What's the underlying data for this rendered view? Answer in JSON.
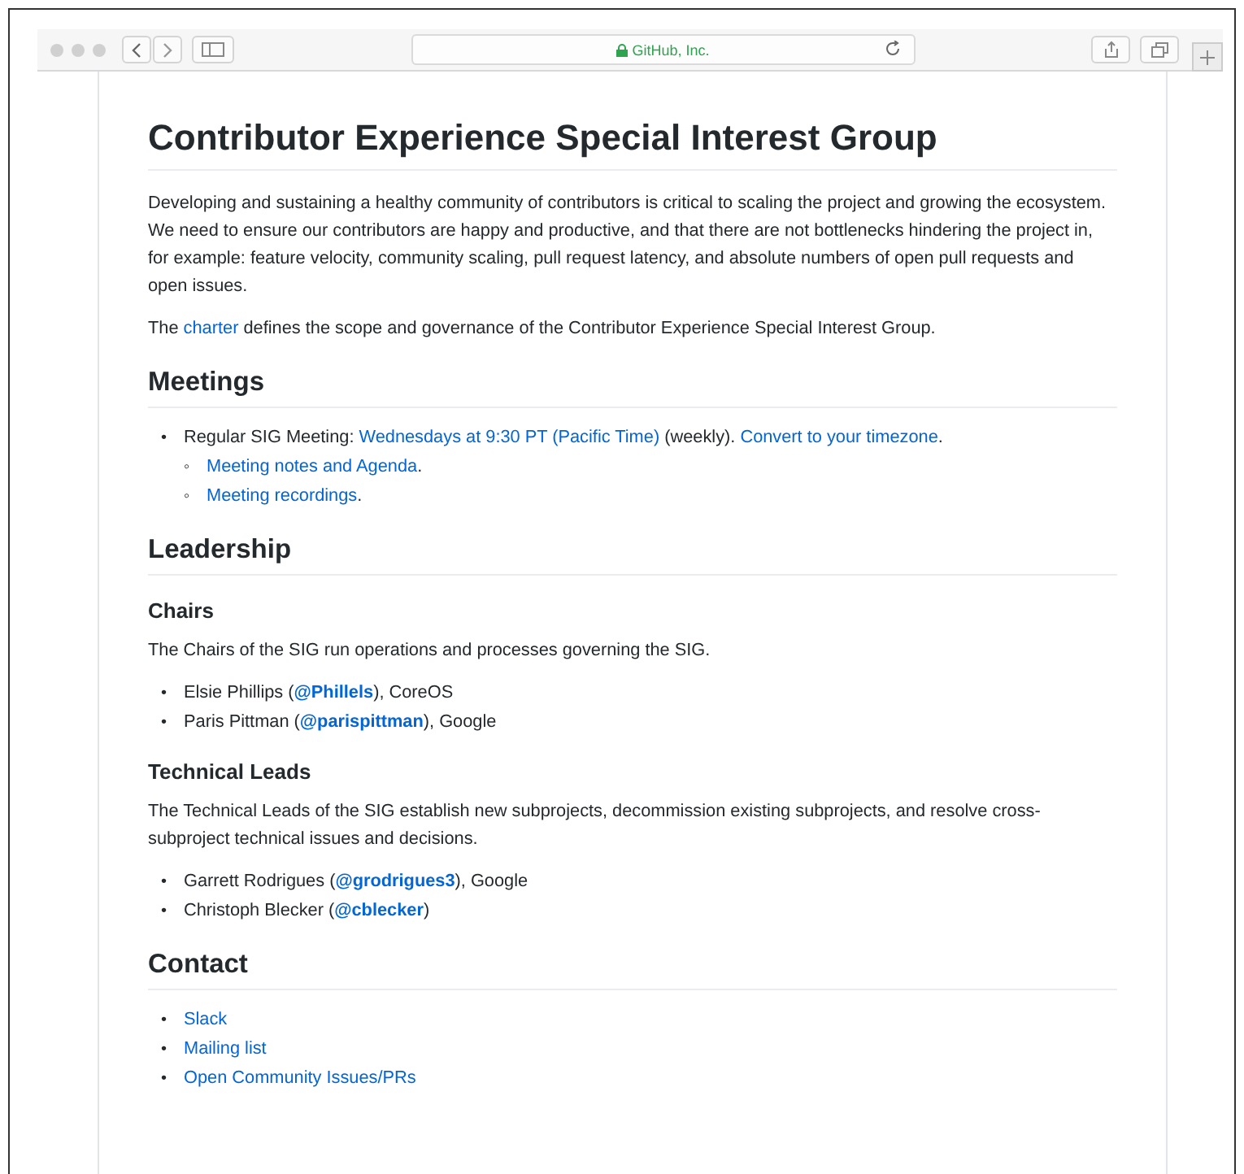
{
  "browser": {
    "address": "GitHub, Inc.",
    "secure": true
  },
  "blocks": [
    {
      "kind": "h1",
      "text": "Contributor Experience Special Interest Group"
    },
    {
      "kind": "p",
      "segments": [
        {
          "kind": "text",
          "text": "Developing and sustaining a healthy community of contributors is critical to scaling the project and growing the ecosystem. We need to ensure our contributors are happy and productive, and that there are not bottlenecks hindering the project in, for example: feature velocity, community scaling, pull request latency, and absolute numbers of open pull requests and open issues."
        }
      ]
    },
    {
      "kind": "p",
      "segments": [
        {
          "kind": "text",
          "text": "The "
        },
        {
          "kind": "link",
          "text": "charter"
        },
        {
          "kind": "text",
          "text": " defines the scope and governance of the Contributor Experience Special Interest Group."
        }
      ]
    },
    {
      "kind": "h2",
      "text": "Meetings"
    },
    {
      "kind": "list",
      "items": [
        {
          "marker": "•",
          "segments": [
            {
              "kind": "text",
              "text": "Regular SIG Meeting: "
            },
            {
              "kind": "link",
              "text": "Wednesdays at 9:30 PT (Pacific Time)"
            },
            {
              "kind": "text",
              "text": " (weekly). "
            },
            {
              "kind": "link",
              "text": "Convert to your timezone"
            },
            {
              "kind": "text",
              "text": "."
            }
          ],
          "children": [
            {
              "marker": "◦",
              "segments": [
                {
                  "kind": "link",
                  "text": "Meeting notes and Agenda"
                },
                {
                  "kind": "text",
                  "text": "."
                }
              ]
            },
            {
              "marker": "◦",
              "segments": [
                {
                  "kind": "link",
                  "text": "Meeting recordings"
                },
                {
                  "kind": "text",
                  "text": "."
                }
              ]
            }
          ]
        }
      ]
    },
    {
      "kind": "h2",
      "text": "Leadership"
    },
    {
      "kind": "h3",
      "text": "Chairs"
    },
    {
      "kind": "p",
      "segments": [
        {
          "kind": "text",
          "text": "The Chairs of the SIG run operations and processes governing the SIG."
        }
      ]
    },
    {
      "kind": "list",
      "items": [
        {
          "marker": "•",
          "segments": [
            {
              "kind": "text",
              "text": "Elsie Phillips ("
            },
            {
              "kind": "handle",
              "text": "@Phillels"
            },
            {
              "kind": "text",
              "text": "), CoreOS"
            }
          ]
        },
        {
          "marker": "•",
          "segments": [
            {
              "kind": "text",
              "text": "Paris Pittman ("
            },
            {
              "kind": "handle",
              "text": "@parispittman"
            },
            {
              "kind": "text",
              "text": "), Google"
            }
          ]
        }
      ]
    },
    {
      "kind": "h3",
      "text": "Technical Leads"
    },
    {
      "kind": "p",
      "segments": [
        {
          "kind": "text",
          "text": "The Technical Leads of the SIG establish new subprojects, decommission existing subprojects, and resolve cross-subproject technical issues and decisions."
        }
      ]
    },
    {
      "kind": "list",
      "items": [
        {
          "marker": "•",
          "segments": [
            {
              "kind": "text",
              "text": "Garrett Rodrigues ("
            },
            {
              "kind": "handle",
              "text": "@grodrigues3"
            },
            {
              "kind": "text",
              "text": "), Google"
            }
          ]
        },
        {
          "marker": "•",
          "segments": [
            {
              "kind": "text",
              "text": "Christoph Blecker ("
            },
            {
              "kind": "handle",
              "text": "@cblecker"
            },
            {
              "kind": "text",
              "text": ")"
            }
          ]
        }
      ]
    },
    {
      "kind": "h2",
      "text": "Contact"
    },
    {
      "kind": "list",
      "items": [
        {
          "marker": "•",
          "segments": [
            {
              "kind": "link",
              "text": "Slack"
            }
          ]
        },
        {
          "marker": "•",
          "segments": [
            {
              "kind": "link",
              "text": "Mailing list"
            }
          ]
        },
        {
          "marker": "•",
          "segments": [
            {
              "kind": "link",
              "text": "Open Community Issues/PRs"
            }
          ]
        }
      ]
    }
  ]
}
